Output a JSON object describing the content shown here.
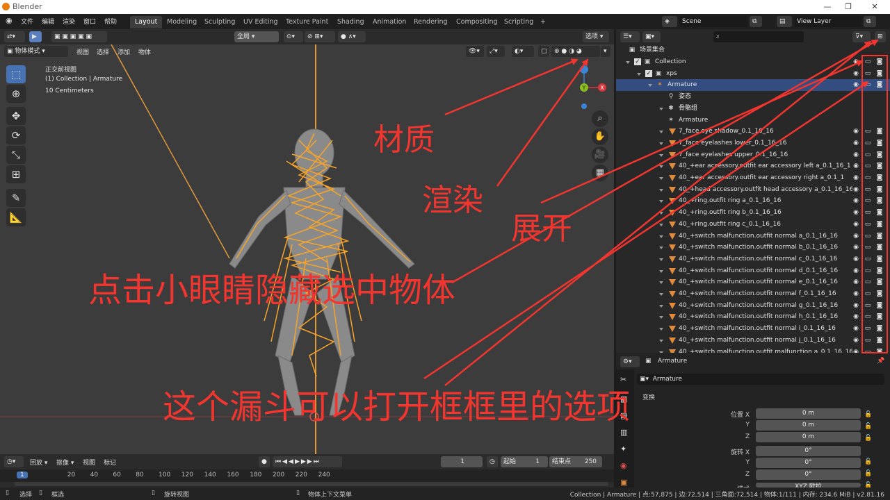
{
  "titlebar": {
    "title": "Blender"
  },
  "menu": {
    "items": [
      "文件",
      "编辑",
      "渲染",
      "窗口",
      "帮助"
    ]
  },
  "workspaces": [
    "Layout",
    "Modeling",
    "Sculpting",
    "UV Editing",
    "Texture Paint",
    "Shading",
    "Animation",
    "Rendering",
    "Compositing",
    "Scripting",
    "+"
  ],
  "scene": {
    "label": "Scene",
    "view_layer": "View Layer"
  },
  "viewport_header": {
    "transform": "全局",
    "options": "选项"
  },
  "viewport_header2": {
    "mode": "物体模式",
    "items": [
      "视图",
      "选择",
      "添加",
      "物体"
    ]
  },
  "overlay": {
    "view": "正交前视图",
    "collection": "(1) Collection | Armature",
    "scale": "10 Centimeters"
  },
  "outliner": {
    "root": "场景集合",
    "rows": [
      {
        "label": "Collection",
        "indent": 1,
        "kind": "collection"
      },
      {
        "label": "xps",
        "indent": 2,
        "kind": "collection"
      },
      {
        "label": "Armature",
        "indent": 3,
        "kind": "armature",
        "selected": true
      },
      {
        "label": "姿态",
        "indent": 4,
        "kind": "pose"
      },
      {
        "label": "骨骼组",
        "indent": 4,
        "kind": "group"
      },
      {
        "label": "Armature",
        "indent": 4,
        "kind": "armdata"
      },
      {
        "label": "7_face eye shadow_0.1_16_16",
        "indent": 4,
        "kind": "mesh"
      },
      {
        "label": "7_face eyelashes lower_0.1_16_16",
        "indent": 4,
        "kind": "mesh"
      },
      {
        "label": "7_face eyelashes upper_0.1_16_16",
        "indent": 4,
        "kind": "mesh"
      },
      {
        "label": "40_+ear accessory.outfit ear accessory left a_0.1_16_1",
        "indent": 4,
        "kind": "mesh"
      },
      {
        "label": "40_+ear accessory.outfit ear accessory right a_0.1_1",
        "indent": 4,
        "kind": "mesh"
      },
      {
        "label": "40_+head accessory.outfit head accessory a_0.1_16_16",
        "indent": 4,
        "kind": "mesh"
      },
      {
        "label": "40_+ring.outfit ring a_0.1_16_16",
        "indent": 4,
        "kind": "mesh"
      },
      {
        "label": "40_+ring.outfit ring b_0.1_16_16",
        "indent": 4,
        "kind": "mesh"
      },
      {
        "label": "40_+ring.outfit ring c_0.1_16_16",
        "indent": 4,
        "kind": "mesh"
      },
      {
        "label": "40_+switch malfunction.outfit normal a_0.1_16_16",
        "indent": 4,
        "kind": "mesh"
      },
      {
        "label": "40_+switch malfunction.outfit normal b_0.1_16_16",
        "indent": 4,
        "kind": "mesh"
      },
      {
        "label": "40_+switch malfunction.outfit normal c_0.1_16_16",
        "indent": 4,
        "kind": "mesh"
      },
      {
        "label": "40_+switch malfunction.outfit normal d_0.1_16_16",
        "indent": 4,
        "kind": "mesh"
      },
      {
        "label": "40_+switch malfunction.outfit normal e_0.1_16_16",
        "indent": 4,
        "kind": "mesh"
      },
      {
        "label": "40_+switch malfunction.outfit normal f_0.1_16_16",
        "indent": 4,
        "kind": "mesh"
      },
      {
        "label": "40_+switch malfunction.outfit normal g_0.1_16_16",
        "indent": 4,
        "kind": "mesh"
      },
      {
        "label": "40_+switch malfunction.outfit normal h_0.1_16_16",
        "indent": 4,
        "kind": "mesh"
      },
      {
        "label": "40_+switch malfunction.outfit normal i_0.1_16_16",
        "indent": 4,
        "kind": "mesh"
      },
      {
        "label": "40_+switch malfunction.outfit normal j_0.1_16_16",
        "indent": 4,
        "kind": "mesh"
      },
      {
        "label": "40_+switch malfunction.outfit malfunction a_0.1_16_16",
        "indent": 4,
        "kind": "mesh"
      }
    ]
  },
  "properties": {
    "header": "Armature",
    "name": "Armature",
    "section": "变换",
    "location": {
      "label": "位置",
      "x": "0 m",
      "y": "0 m",
      "z": "0 m"
    },
    "rotation": {
      "label": "旋转",
      "x": "0°",
      "y": "0°",
      "z": "0°"
    },
    "axis": {
      "x": "X",
      "y": "Y",
      "z": "Z"
    },
    "mode_label": "模式",
    "mode_value": "XYZ 欧拉"
  },
  "timeline": {
    "menus": [
      "回放",
      "抠像",
      "视图",
      "标记"
    ],
    "current_frame": "1",
    "start_label": "起始",
    "start": "1",
    "end_label": "结束点",
    "end": "250",
    "ruler": [
      "1",
      "20",
      "40",
      "60",
      "80",
      "100",
      "120",
      "140",
      "160",
      "180",
      "200",
      "220",
      "240"
    ]
  },
  "statusbar": {
    "select": "选择",
    "box": "框选",
    "rotate": "旋转视图",
    "context": "物体上下文菜单",
    "info": "Collection | Armature | 点:57,875 | 边:72,514 | 三角面:72,514 | 物体:1/111 | 内存: 234.6 MiB | v2.81.16"
  },
  "annotations": {
    "material": "材质",
    "render": "渲染",
    "expand": "展开",
    "hide": "点击小眼睛隐藏选中物体",
    "funnel": "这个漏斗可以打开框框里的选项"
  },
  "colors": {
    "annotation": "#f2352f",
    "bone": "#f7a429",
    "selection": "#4772b3",
    "axis_x": "#d8373d",
    "axis_y": "#8cbf1f",
    "axis_z": "#3b83d4"
  }
}
